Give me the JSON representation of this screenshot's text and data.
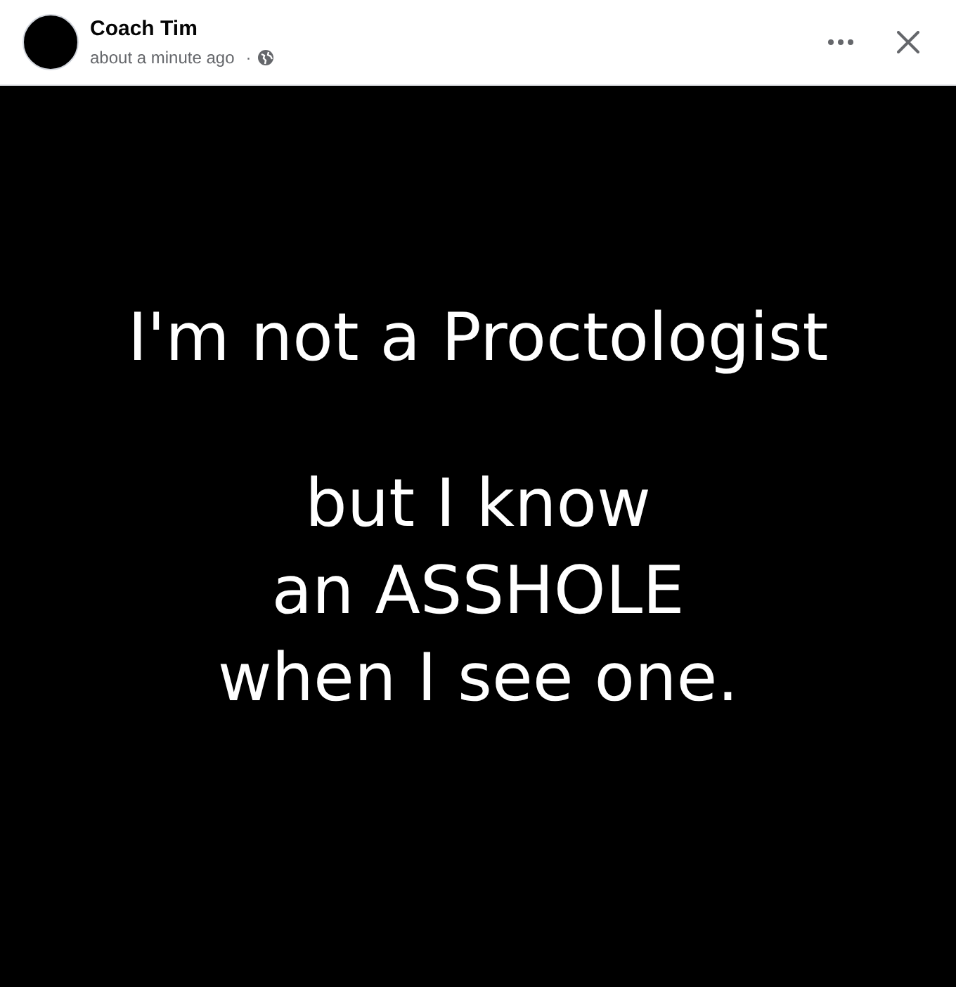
{
  "post": {
    "author": "Coach Tim",
    "time": "about a minute ago",
    "separator": "·"
  },
  "image": {
    "paragraphs": [
      [
        "I'm not a Proctologist"
      ],
      [
        "but I know",
        "an ASSHOLE",
        "when I see one."
      ]
    ]
  }
}
